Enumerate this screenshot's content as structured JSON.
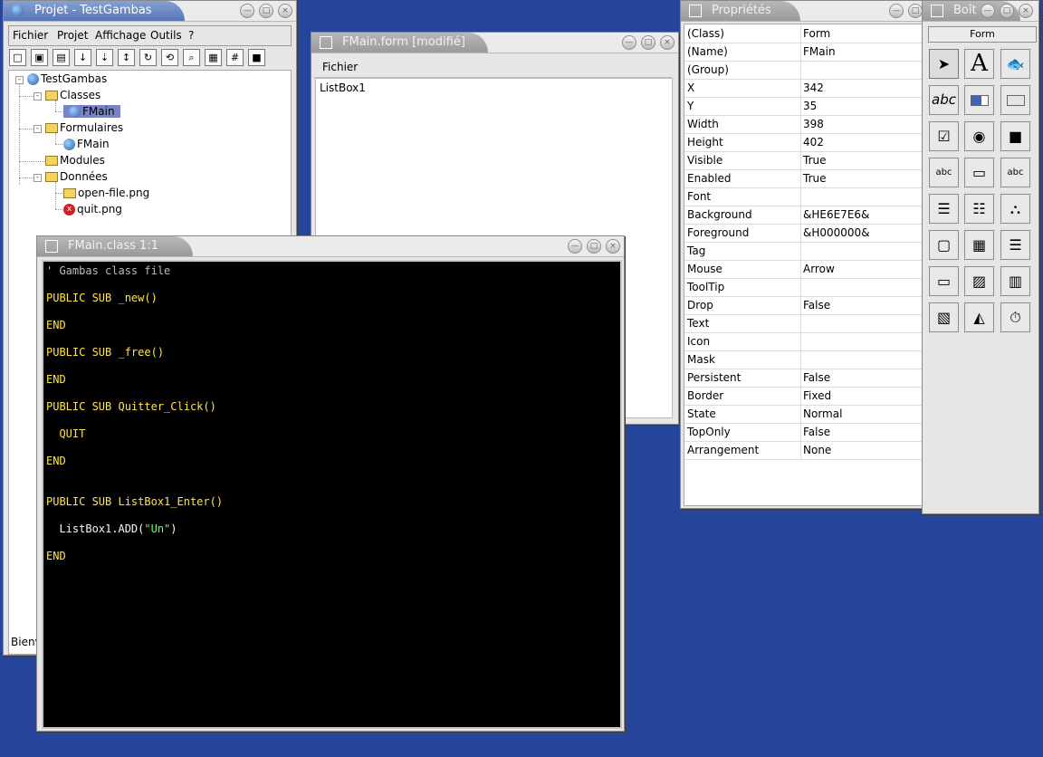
{
  "project": {
    "title": "Projet - TestGambas",
    "menu": [
      "Fichier",
      "Projet",
      "Affichage",
      "Outils",
      "?"
    ],
    "tree": {
      "root": "TestGambas",
      "classes": "Classes",
      "class_item": "FMain",
      "forms": "Formulaires",
      "form_item": "FMain",
      "modules": "Modules",
      "data": "Données",
      "data_items": [
        "open-file.png",
        "quit.png"
      ]
    },
    "status": "Bienv"
  },
  "form_window": {
    "title": "FMain.form [modifié]",
    "menu_label": "Fichier",
    "listbox": "ListBox1"
  },
  "code_window": {
    "title": "FMain.class 1:1",
    "lines": [
      {
        "text": "' Gambas class file",
        "kind": "comment"
      },
      {
        "text": "PUBLIC SUB _new()",
        "kind": "code"
      },
      {
        "text": "END",
        "kind": "keyword"
      },
      {
        "text": "PUBLIC SUB _free()",
        "kind": "code"
      },
      {
        "text": "END",
        "kind": "keyword"
      },
      {
        "text": "PUBLIC SUB Quitter_Click()",
        "kind": "code"
      },
      {
        "text": "  QUIT",
        "kind": "keyword"
      },
      {
        "text": "END",
        "kind": "keyword"
      },
      {
        "text": "PUBLIC SUB ListBox1_Enter()",
        "kind": "code"
      },
      {
        "text": "  ListBox1.ADD(\"Un\")",
        "kind": "string"
      },
      {
        "text": "END",
        "kind": "keyword"
      }
    ]
  },
  "properties": {
    "title": "Propriétés",
    "rows": [
      [
        "(Class)",
        "Form"
      ],
      [
        "(Name)",
        "FMain"
      ],
      [
        "(Group)",
        ""
      ],
      [
        "X",
        "342"
      ],
      [
        "Y",
        "35"
      ],
      [
        "Width",
        "398"
      ],
      [
        "Height",
        "402"
      ],
      [
        "Visible",
        "True"
      ],
      [
        "Enabled",
        "True"
      ],
      [
        "Font",
        ""
      ],
      [
        "Background",
        "&HE6E7E6&"
      ],
      [
        "Foreground",
        "&H000000&"
      ],
      [
        "Tag",
        ""
      ],
      [
        "Mouse",
        "Arrow"
      ],
      [
        "ToolTip",
        ""
      ],
      [
        "Drop",
        "False"
      ],
      [
        "Text",
        ""
      ],
      [
        "Icon",
        ""
      ],
      [
        "Mask",
        ""
      ],
      [
        "Persistent",
        "False"
      ],
      [
        "Border",
        "Fixed"
      ],
      [
        "State",
        "Normal"
      ],
      [
        "TopOnly",
        "False"
      ],
      [
        "Arrangement",
        "None"
      ]
    ]
  },
  "toolbox": {
    "title": "Boît",
    "form_label": "Form",
    "text_a": "A",
    "text_abc": "abc"
  },
  "colors": {
    "desktop": "#26449a",
    "title_active": "#5b78b8",
    "title_inactive": "#a7a7a7",
    "code_bg": "#000000",
    "keyword": "#ffe44c",
    "string": "#64ff64"
  }
}
